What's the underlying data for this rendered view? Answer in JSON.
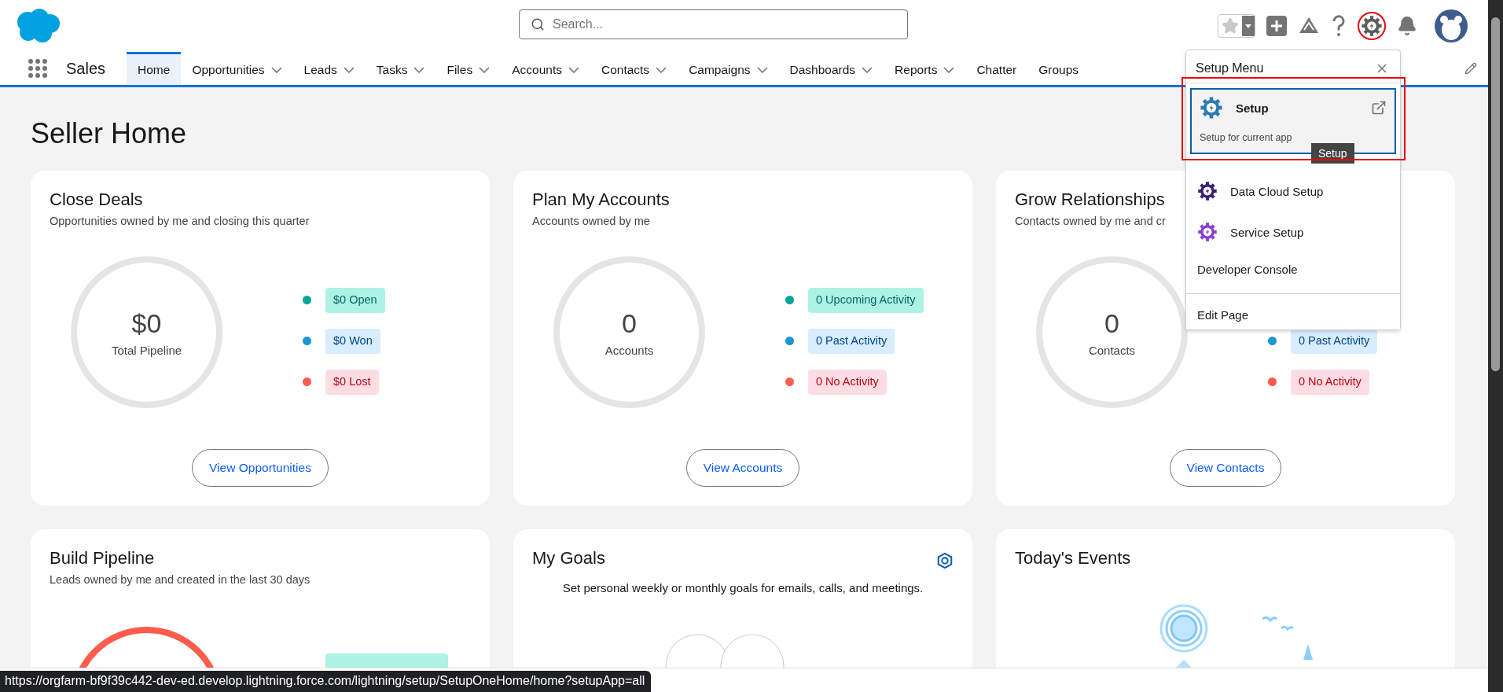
{
  "app": {
    "name": "Sales"
  },
  "search": {
    "placeholder": "Search..."
  },
  "nav": [
    {
      "label": "Home",
      "selected": true,
      "dropdown": false
    },
    {
      "label": "Opportunities",
      "selected": false,
      "dropdown": true
    },
    {
      "label": "Leads",
      "selected": false,
      "dropdown": true
    },
    {
      "label": "Tasks",
      "selected": false,
      "dropdown": true
    },
    {
      "label": "Files",
      "selected": false,
      "dropdown": true
    },
    {
      "label": "Accounts",
      "selected": false,
      "dropdown": true
    },
    {
      "label": "Contacts",
      "selected": false,
      "dropdown": true
    },
    {
      "label": "Campaigns",
      "selected": false,
      "dropdown": true
    },
    {
      "label": "Dashboards",
      "selected": false,
      "dropdown": true
    },
    {
      "label": "Reports",
      "selected": false,
      "dropdown": true
    },
    {
      "label": "Chatter",
      "selected": false,
      "dropdown": false
    },
    {
      "label": "Groups",
      "selected": false,
      "dropdown": false
    }
  ],
  "page": {
    "title": "Seller Home"
  },
  "cards": [
    {
      "kind": "metric",
      "title": "Close Deals",
      "subtitle": "Opportunities owned by me and closing this quarter",
      "total": {
        "value": "$0",
        "label": "Total Pipeline"
      },
      "legend": [
        {
          "kind": "positive",
          "color": "#06a59a",
          "label": "$0 Open"
        },
        {
          "kind": "neutral",
          "color": "#1b96d4",
          "label": "$0 Won"
        },
        {
          "kind": "negative",
          "color": "#fe5c4c",
          "label": "$0 Lost"
        }
      ],
      "button": "View Opportunities"
    },
    {
      "kind": "metric",
      "title": "Plan My Accounts",
      "subtitle": "Accounts owned by me",
      "total": {
        "value": "0",
        "label": "Accounts"
      },
      "legend": [
        {
          "kind": "positive",
          "color": "#06a59a",
          "label": "0 Upcoming Activity"
        },
        {
          "kind": "neutral",
          "color": "#1b96d4",
          "label": "0 Past Activity"
        },
        {
          "kind": "negative",
          "color": "#fe5c4c",
          "label": "0 No Activity"
        }
      ],
      "button": "View Accounts"
    },
    {
      "kind": "metric",
      "title": "Grow Relationships",
      "subtitle": "Contacts owned by me and cr",
      "total": {
        "value": "0",
        "label": "Contacts"
      },
      "legend": [
        {
          "kind": "neutral",
          "color": "#1b96d4",
          "label": "0 Past Activity"
        },
        {
          "kind": "negative",
          "color": "#fe5c4c",
          "label": "0 No Activity"
        }
      ],
      "button": "View Contacts"
    },
    {
      "kind": "metric",
      "title": "Build Pipeline",
      "subtitle": "Leads owned by me and created in the last 30 days",
      "color": "#fe5c4c",
      "legend": [
        {
          "kind": "positive"
        }
      ]
    },
    {
      "kind": "goals",
      "title": "My Goals",
      "subtitle": "Set personal weekly or monthly goals for emails, calls, and meetings."
    },
    {
      "kind": "events",
      "title": "Today's Events"
    }
  ],
  "setup_menu": {
    "title": "Setup Menu",
    "featured": {
      "title": "Setup",
      "description": "Setup for current app",
      "tooltip": "Setup"
    },
    "items": [
      {
        "kind": "app",
        "label": "Data Cloud Setup",
        "color": "#3b1f73"
      },
      {
        "kind": "app",
        "label": "Service Setup",
        "color": "#8a3fd1"
      },
      {
        "kind": "link",
        "label": "Developer Console"
      },
      {
        "kind": "separated",
        "label": "Edit Page"
      }
    ]
  },
  "status_url": "https://orgfarm-bf9f39c442-dev-ed.develop.lightning.force.com/lightning/setup/SetupOneHome/home?setupApp=all"
}
